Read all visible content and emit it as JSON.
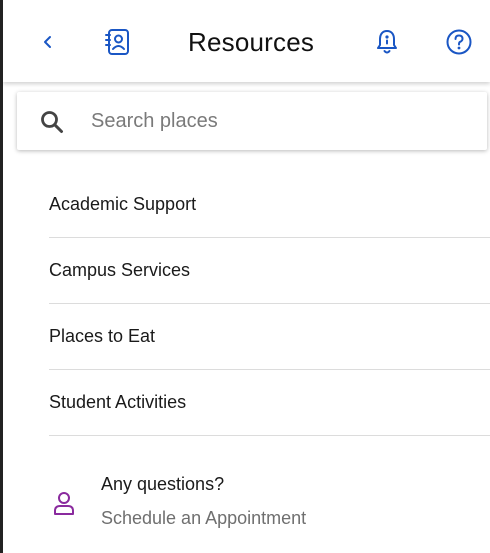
{
  "header": {
    "title": "Resources",
    "back_icon": "chevron-left-icon",
    "contact_icon": "contact-book-icon",
    "notification_icon": "bell-icon",
    "help_icon": "help-circle-icon"
  },
  "search": {
    "placeholder": "Search places",
    "value": "",
    "icon": "search-icon"
  },
  "resources": {
    "items": [
      {
        "label": "Academic Support"
      },
      {
        "label": "Campus Services"
      },
      {
        "label": "Places to Eat"
      },
      {
        "label": "Student Activities"
      }
    ]
  },
  "help_section": {
    "question": "Any questions?",
    "link_label": "Schedule an Appointment",
    "icon": "person-icon"
  },
  "colors": {
    "primary_icon": "#1a56c4",
    "accent_purple": "#8a2a9e",
    "divider": "#dcdcdc"
  }
}
